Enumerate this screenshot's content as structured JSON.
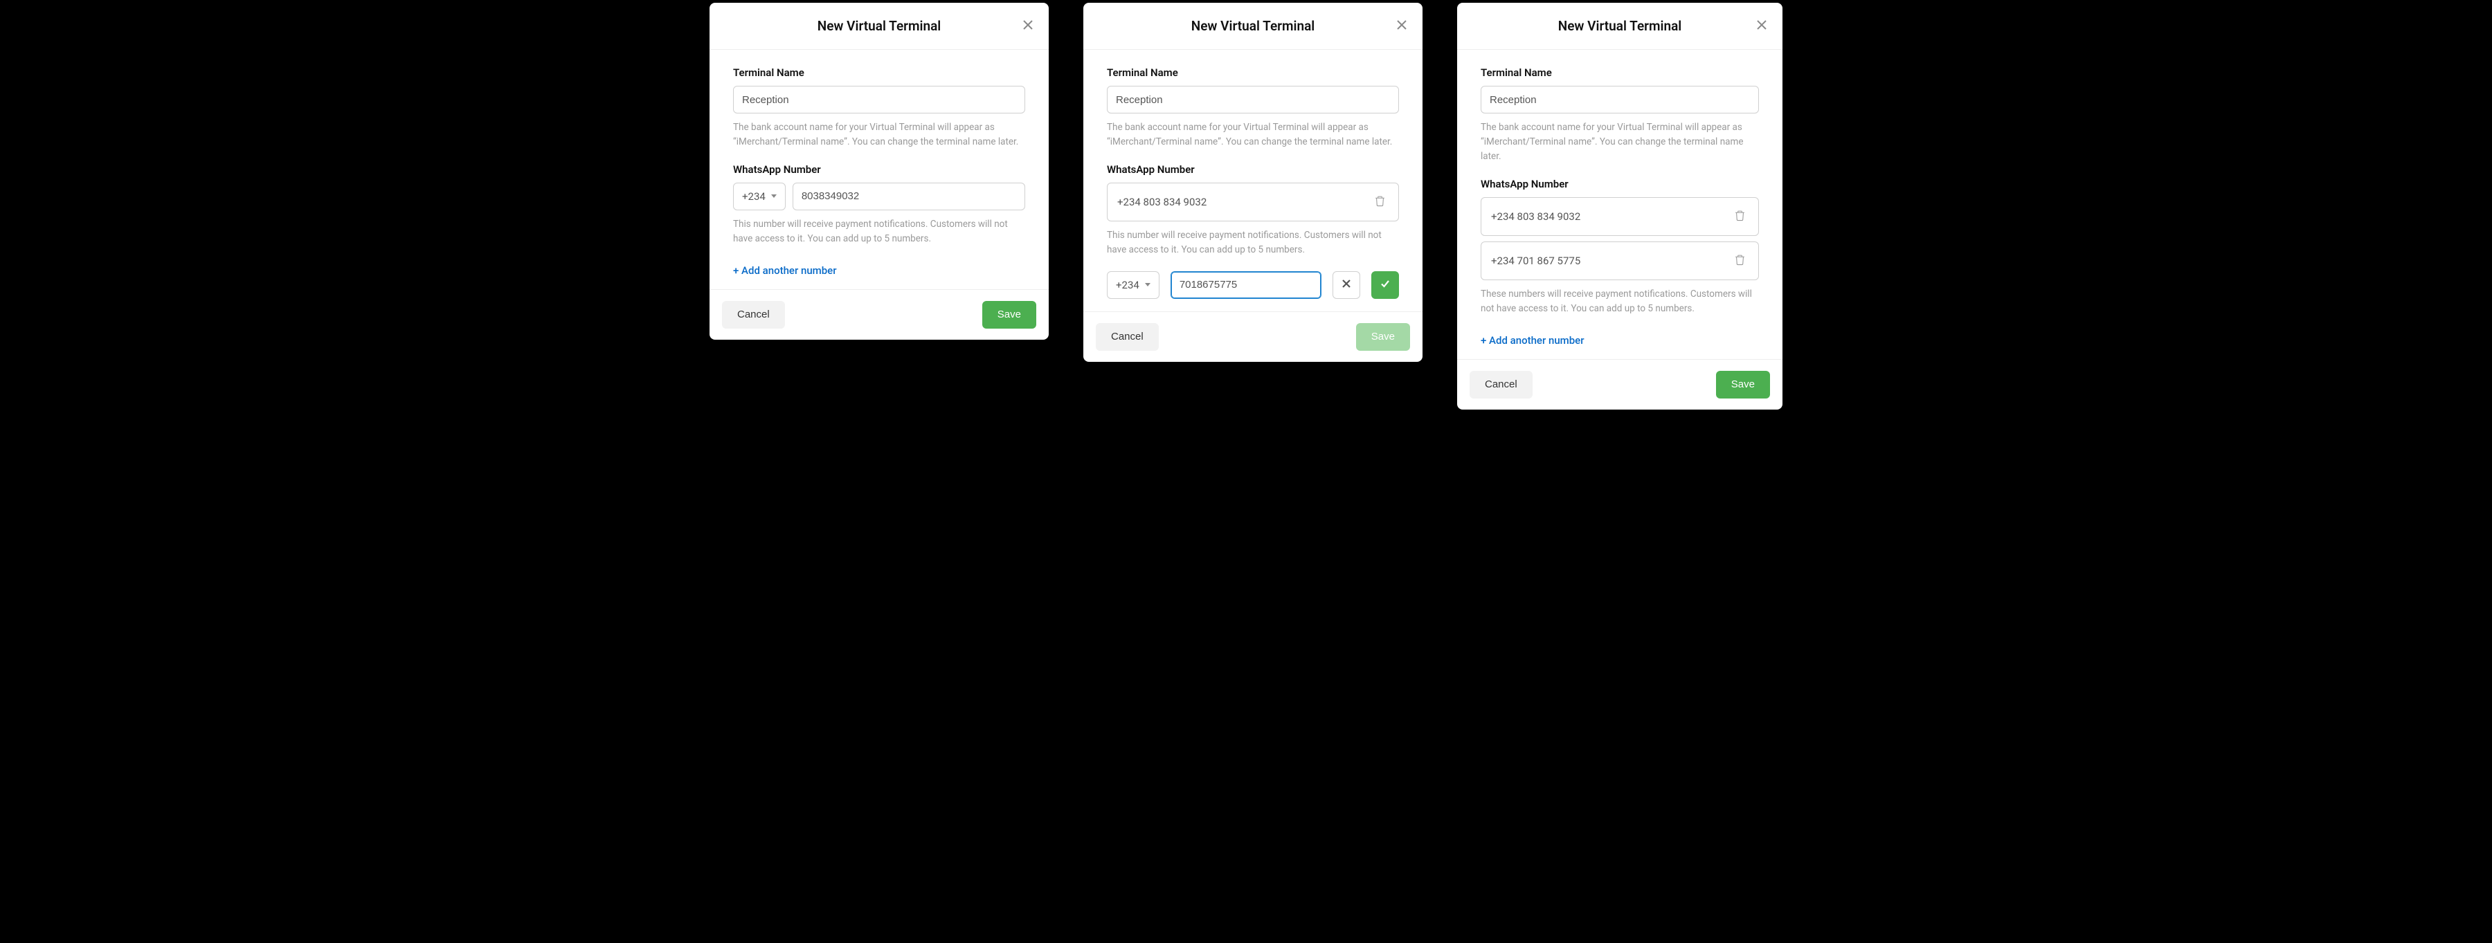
{
  "modals": [
    {
      "title": "New Virtual Terminal",
      "terminal_label": "Terminal Name",
      "terminal_value": "Reception",
      "terminal_helper": "The bank account name for your Virtual Terminal will appear as “iMerchant/Terminal name”. You can change the terminal name later.",
      "whatsapp_label": "WhatsApp Number",
      "country_code": "+234",
      "phone_value": "8038349032",
      "whatsapp_helper": "This number will receive payment notifications. Customers will not have access to it. You can add up to 5 numbers.",
      "add_link": "+ Add another number",
      "cancel": "Cancel",
      "save": "Save"
    },
    {
      "title": "New Virtual Terminal",
      "terminal_label": "Terminal Name",
      "terminal_value": "Reception",
      "terminal_helper": "The bank account name for your Virtual Terminal will appear as “iMerchant/Terminal name”. You can change the terminal name later.",
      "whatsapp_label": "WhatsApp Number",
      "saved_numbers": [
        "+234 803 834 9032"
      ],
      "whatsapp_helper": "This number will receive payment notifications. Customers will not have access to it. You can add up to 5 numbers.",
      "country_code": "+234",
      "edit_value": "7018675775",
      "cancel": "Cancel",
      "save": "Save"
    },
    {
      "title": "New Virtual Terminal",
      "terminal_label": "Terminal Name",
      "terminal_value": "Reception",
      "terminal_helper": "The bank account name for your Virtual Terminal will appear as “iMerchant/Terminal name”. You can change the terminal name later.",
      "whatsapp_label": "WhatsApp Number",
      "saved_numbers": [
        "+234 803 834 9032",
        "+234 701 867 5775"
      ],
      "whatsapp_helper": "These numbers will receive payment notifications. Customers will not have access to it. You can add up to 5 numbers.",
      "add_link": "+ Add another number",
      "cancel": "Cancel",
      "save": "Save"
    }
  ]
}
